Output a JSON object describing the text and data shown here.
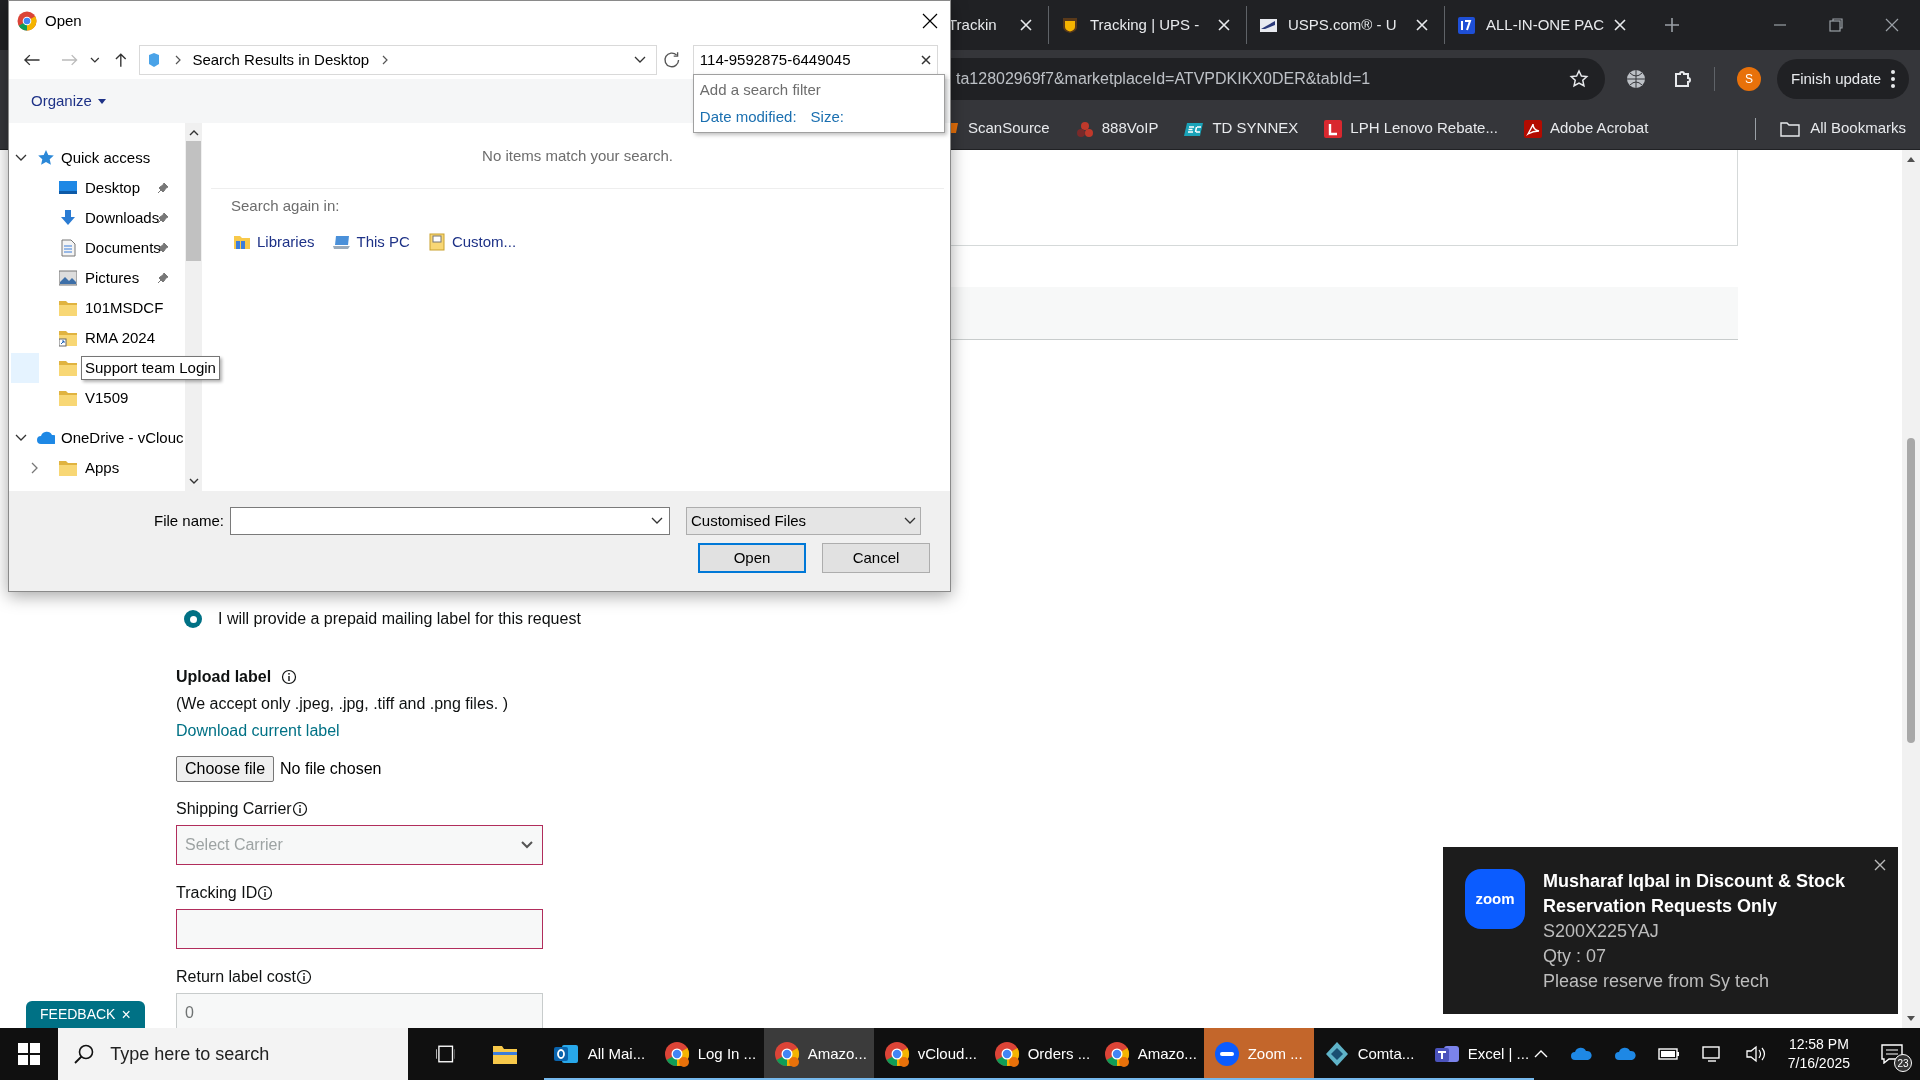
{
  "browser": {
    "tabs": [
      {
        "label": "Trackin",
        "kind": "plain"
      },
      {
        "label": "Tracking | UPS - ",
        "kind": "ups"
      },
      {
        "label": "USPS.com® - U",
        "kind": "usps"
      },
      {
        "label": "ALL-IN-ONE PAC",
        "kind": "seventeen"
      }
    ],
    "address_bar": {
      "url": "ta12802969f7&marketplaceId=ATVPDKIKX0DER&tabId=1"
    },
    "profile_initial": "S",
    "update_button": "Finish update",
    "bookmarks": [
      {
        "label": "ScanSource",
        "kind": "scansource"
      },
      {
        "label": "888VoIP",
        "kind": "voip"
      },
      {
        "label": "TD SYNNEX",
        "kind": "ec"
      },
      {
        "label": "LPH Lenovo Rebate...",
        "kind": "letter-l"
      },
      {
        "label": "Adobe Acrobat",
        "kind": "pdf"
      }
    ],
    "all_bookmarks": "All Bookmarks"
  },
  "page": {
    "radio": {
      "label": "I will provide a prepaid mailing label for this request",
      "selected": true
    },
    "upload": {
      "title": "Upload label",
      "note": "(We accept only .jpeg, .jpg, .tiff and .png files. )",
      "link": "Download current label"
    },
    "file_input": {
      "button": "Choose file",
      "status": "No file chosen"
    },
    "fields": [
      {
        "label": "Shipping Carrier",
        "kind": "select",
        "placeholder": "Select Carrier",
        "invalid": true
      },
      {
        "label": "Tracking ID",
        "kind": "text",
        "invalid": true
      },
      {
        "label": "Return label cost",
        "kind": "text",
        "value": "0",
        "invalid": false
      }
    ],
    "feedback": {
      "label": "FEEDBACK",
      "close": "×"
    }
  },
  "dialog": {
    "title": "Open",
    "location": "Search Results in Desktop",
    "search": {
      "value": "114-9592875-6449045"
    },
    "search_filter": {
      "heading": "Add a search filter",
      "filters": [
        "Date modified:",
        "Size:"
      ]
    },
    "organize": "Organize",
    "tree": [
      {
        "label": "Quick access",
        "kind": "star",
        "expanded": true,
        "children": [
          {
            "label": "Desktop",
            "kind": "desktop",
            "pinned": true,
            "hovered": false
          },
          {
            "label": "Downloads",
            "kind": "download",
            "pinned": true,
            "hovered": false
          },
          {
            "label": "Documents",
            "kind": "documents",
            "pinned": true,
            "hovered": false
          },
          {
            "label": "Pictures",
            "kind": "pictures",
            "pinned": true,
            "hovered": false
          },
          {
            "label": "101MSDCF",
            "kind": "folder",
            "pinned": false,
            "hovered": false
          },
          {
            "label": "RMA 2024",
            "kind": "shortcut",
            "pinned": false,
            "hovered": false
          },
          {
            "label": "Support team Login",
            "kind": "folder",
            "pinned": false,
            "hovered": true
          },
          {
            "label": "V1509",
            "kind": "folder",
            "pinned": false,
            "hovered": false
          }
        ]
      },
      {
        "label": "OneDrive - vClouc",
        "kind": "cloud",
        "expanded": true,
        "children": [
          {
            "label": "Apps",
            "kind": "folder",
            "expanded": false
          }
        ]
      }
    ],
    "message": "No items match your search.",
    "search_again": {
      "heading": "Search again in:",
      "places": [
        {
          "label": "Libraries",
          "kind": "libraries"
        },
        {
          "label": "This PC",
          "kind": "pc"
        },
        {
          "label": "Custom...",
          "kind": "custom"
        }
      ]
    },
    "file_name_label": "File name:",
    "file_type": "Customised Files",
    "buttons": [
      {
        "label": "Open",
        "default": true
      },
      {
        "label": "Cancel",
        "default": false
      }
    ]
  },
  "notification": {
    "icon_label": "zoom",
    "title": "Musharaf Iqbal in Discount & Stock Reservation Requests Only",
    "lines": [
      "S200X225YAJ",
      "Qty : 07",
      "Please reserve from Sy tech"
    ]
  },
  "taskbar": {
    "search_placeholder": "Type here to search",
    "apps": [
      {
        "label": "All Mai...",
        "kind": "outlook",
        "active": false,
        "flashing": false
      },
      {
        "label": "Log In ...",
        "kind": "chrome",
        "active": false,
        "flashing": false
      },
      {
        "label": "Amazo...",
        "kind": "chrome",
        "active": true,
        "flashing": false
      },
      {
        "label": "vCloud...",
        "kind": "chrome",
        "active": false,
        "flashing": false
      },
      {
        "label": "Orders ...",
        "kind": "chrome",
        "active": false,
        "flashing": false
      },
      {
        "label": "Amazo...",
        "kind": "chrome",
        "active": false,
        "flashing": false
      },
      {
        "label": "Zoom ...",
        "kind": "zoom",
        "active": false,
        "flashing": true
      },
      {
        "label": "Comta...",
        "kind": "comtax",
        "active": false,
        "flashing": false
      },
      {
        "label": "Excel | ...",
        "kind": "teams",
        "active": false,
        "flashing": false
      }
    ],
    "time": "12:58 PM",
    "date": "7/16/2025",
    "notifications": "23"
  }
}
